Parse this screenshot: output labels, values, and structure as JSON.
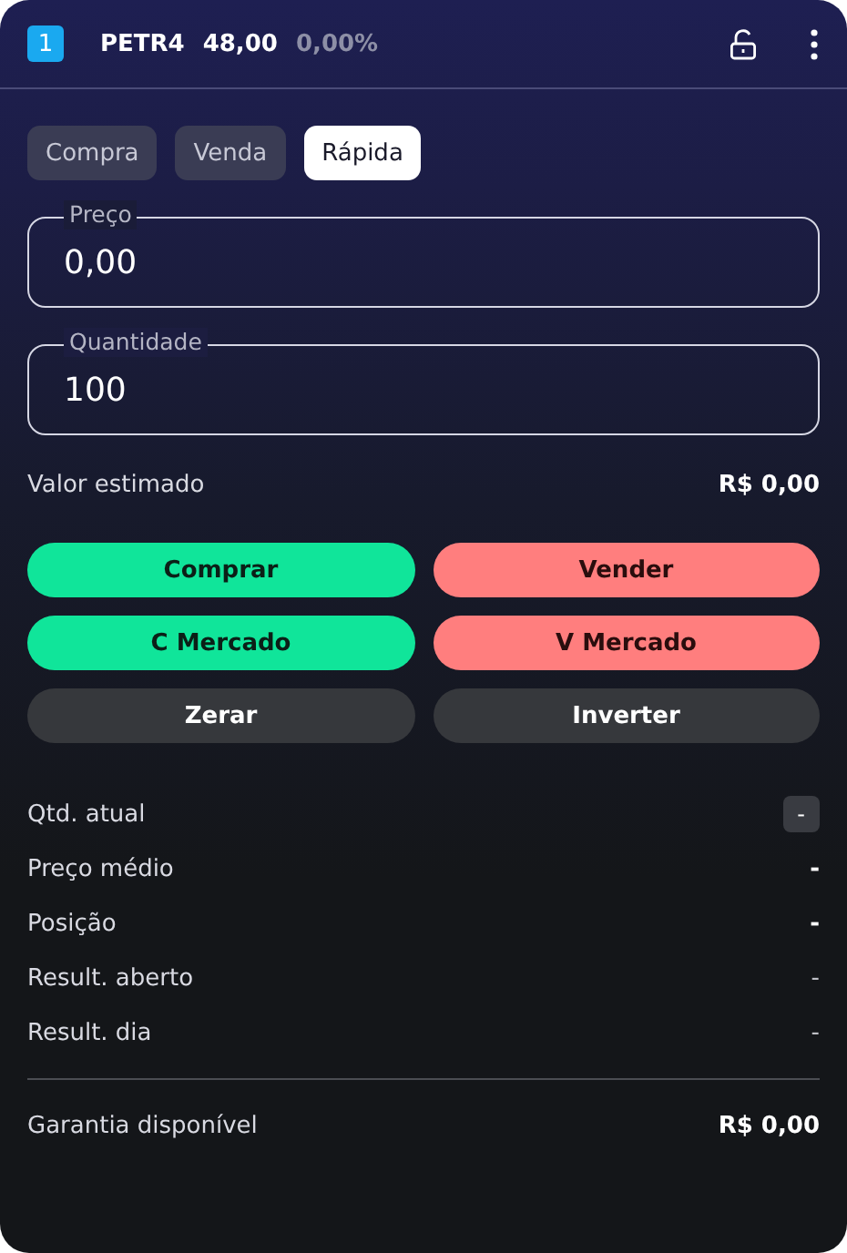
{
  "header": {
    "badge": "1",
    "symbol": "PETR4",
    "price": "48,00",
    "change": "0,00%"
  },
  "tabs": [
    {
      "label": "Compra",
      "selected": false
    },
    {
      "label": "Venda",
      "selected": false
    },
    {
      "label": "Rápida",
      "selected": true
    }
  ],
  "fields": [
    {
      "label": "Preço",
      "value": "0,00"
    },
    {
      "label": "Quantidade",
      "value": "100"
    }
  ],
  "estimate": {
    "label": "Valor estimado",
    "value": "R$ 0,00"
  },
  "buttons": [
    {
      "label": "Comprar",
      "kind": "buy"
    },
    {
      "label": "Vender",
      "kind": "sell"
    },
    {
      "label": "C Mercado",
      "kind": "buy"
    },
    {
      "label": "V Mercado",
      "kind": "sell"
    },
    {
      "label": "Zerar",
      "kind": "neutral"
    },
    {
      "label": "Inverter",
      "kind": "neutral"
    }
  ],
  "stats": [
    {
      "label": "Qtd. atual",
      "value": "-",
      "kind": "badge"
    },
    {
      "label": "Preço médio",
      "value": "-",
      "kind": "bold"
    },
    {
      "label": "Posição",
      "value": "-",
      "kind": "bold"
    },
    {
      "label": "Result. aberto",
      "value": "-",
      "kind": "plain"
    },
    {
      "label": "Result. dia",
      "value": "-",
      "kind": "plain"
    }
  ],
  "collateral": {
    "label": "Garantia disponível",
    "value": "R$ 0,00"
  }
}
